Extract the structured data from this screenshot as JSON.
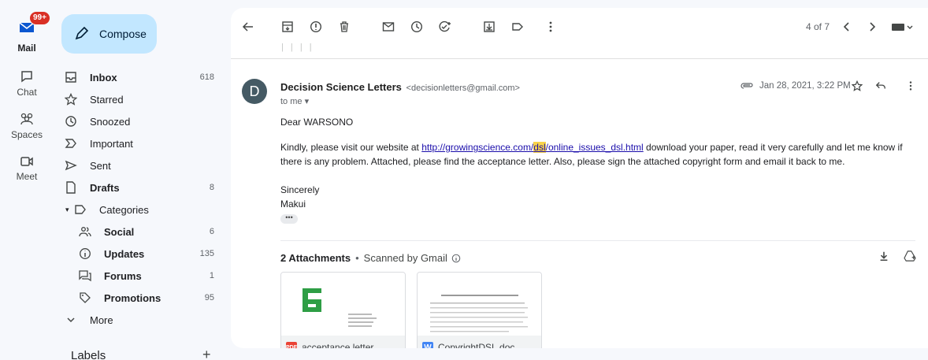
{
  "rail": {
    "mail_badge": "99+",
    "mail_label": "Mail",
    "chat_label": "Chat",
    "spaces_label": "Spaces",
    "meet_label": "Meet"
  },
  "compose": {
    "label": "Compose"
  },
  "nav": {
    "inbox": {
      "label": "Inbox",
      "count": "618"
    },
    "starred": {
      "label": "Starred"
    },
    "snoozed": {
      "label": "Snoozed"
    },
    "important": {
      "label": "Important"
    },
    "sent": {
      "label": "Sent"
    },
    "drafts": {
      "label": "Drafts",
      "count": "8"
    },
    "categories": {
      "label": "Categories"
    },
    "social": {
      "label": "Social",
      "count": "6"
    },
    "updates": {
      "label": "Updates",
      "count": "135"
    },
    "forums": {
      "label": "Forums",
      "count": "1"
    },
    "promotions": {
      "label": "Promotions",
      "count": "95"
    },
    "more": {
      "label": "More"
    },
    "labels": {
      "label": "Labels",
      "add": "+"
    }
  },
  "toolbar": {
    "pager": "4 of 7"
  },
  "message": {
    "avatar_letter": "D",
    "sender_name": "Decision Science Letters",
    "sender_email": "<decisionletters@gmail.com>",
    "to": "to me",
    "date": "Jan 28, 2021, 3:22 PM",
    "greeting": "Dear WARSONO",
    "para_pre": "Kindly, please visit our website at ",
    "link_a": "http://growingscience.com/",
    "link_hl": "dsl",
    "link_b": "/online_issues_dsl.html",
    "para_post": " download your paper, read it very carefully and let me know if there is any problem. Attached, please find the acceptance letter. Also, please sign the attached copyright form and email it back to me.",
    "sign1": "Sincerely",
    "sign2": "Makui",
    "ellipsis": "•••"
  },
  "attachments": {
    "count_label": "2 Attachments",
    "dot": "•",
    "scanned": "Scanned by Gmail",
    "items": [
      {
        "type": "PDF",
        "name": "acceptance letter..."
      },
      {
        "type": "W",
        "name": "CopyrightDSL.doc"
      }
    ]
  },
  "colors": {
    "compose_bg": "#c2e7ff",
    "badge": "#d93025",
    "link": "#1a0dab",
    "highlight": "#f8d34a"
  }
}
